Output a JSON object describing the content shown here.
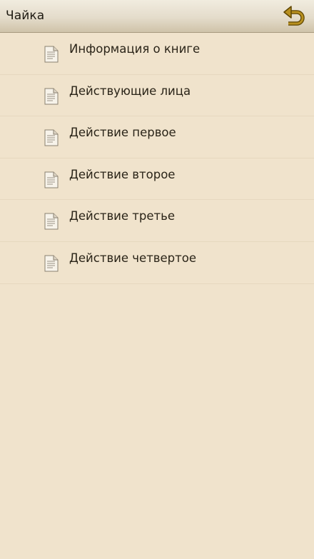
{
  "app_bar": {
    "title": "Чайка",
    "back_icon": "undo-arrow-icon",
    "accent_color": "#7a5a00"
  },
  "chapters": [
    {
      "label": "Информация о книге",
      "icon": "document-icon"
    },
    {
      "label": "Действующие лица",
      "icon": "document-icon"
    },
    {
      "label": "Действие первое",
      "icon": "document-icon"
    },
    {
      "label": "Действие второе",
      "icon": "document-icon"
    },
    {
      "label": "Действие третье",
      "icon": "document-icon"
    },
    {
      "label": "Действие четвертое",
      "icon": "document-icon"
    }
  ]
}
